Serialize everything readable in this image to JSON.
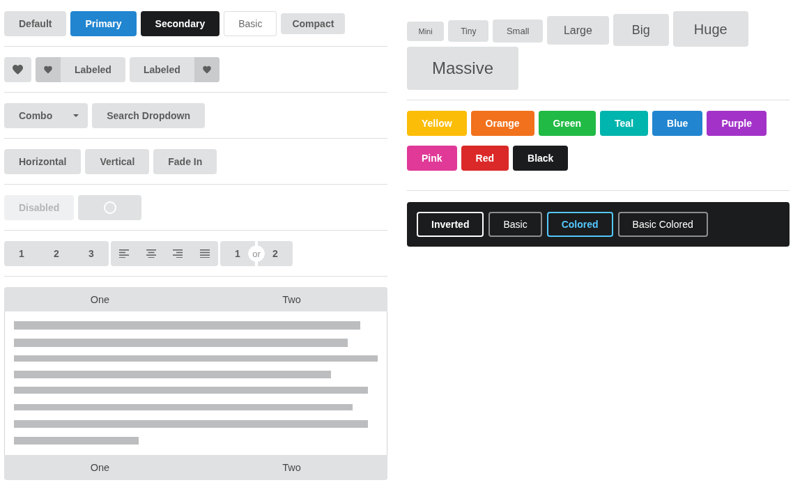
{
  "left": {
    "basic_buttons": [
      {
        "label": "Default",
        "kind": "default"
      },
      {
        "label": "Primary",
        "kind": "primary"
      },
      {
        "label": "Secondary",
        "kind": "secondary"
      },
      {
        "label": "Basic",
        "kind": "basic"
      },
      {
        "label": "Compact",
        "kind": "compact"
      }
    ],
    "icon_buttons": [
      {
        "kind": "icon"
      },
      {
        "kind": "labeled_left",
        "label": "Labeled"
      },
      {
        "kind": "labeled_right",
        "label": "Labeled"
      }
    ],
    "dropdown_buttons": [
      {
        "kind": "combo",
        "label": "Combo"
      },
      {
        "kind": "plain",
        "label": "Search Dropdown"
      }
    ],
    "animated_buttons": [
      {
        "label": "Horizontal"
      },
      {
        "label": "Vertical"
      },
      {
        "label": "Fade In"
      }
    ],
    "state_buttons": [
      {
        "kind": "text",
        "label": "Disabled",
        "disabled": true
      },
      {
        "kind": "loading",
        "disabled": false
      }
    ],
    "number_group": [
      "1",
      "2",
      "3"
    ],
    "align_group": [
      {
        "kind": "left"
      },
      {
        "kind": "center"
      },
      {
        "kind": "right"
      },
      {
        "kind": "justify"
      }
    ],
    "or_group": {
      "first": "1",
      "separator": "or",
      "second": "2"
    },
    "attached_top": [
      {
        "label": "One"
      },
      {
        "label": "Two"
      }
    ],
    "attached_bottom": [
      {
        "label": "One"
      },
      {
        "label": "Two"
      }
    ]
  },
  "right": {
    "size_buttons": [
      {
        "kind": "mini",
        "label": "Mini"
      },
      {
        "kind": "tiny",
        "label": "Tiny"
      },
      {
        "kind": "small",
        "label": "Small"
      },
      {
        "kind": "large",
        "label": "Large"
      },
      {
        "kind": "big",
        "label": "Big"
      },
      {
        "kind": "huge",
        "label": "Huge"
      },
      {
        "kind": "massive",
        "label": "Massive"
      }
    ],
    "colored_buttons": [
      {
        "label": "Yellow",
        "color": "#fbbd08"
      },
      {
        "label": "Orange",
        "color": "#f2711c"
      },
      {
        "label": "Green",
        "color": "#21ba45"
      },
      {
        "label": "Teal",
        "color": "#00b5ad"
      },
      {
        "label": "Blue",
        "color": "#2185d0"
      },
      {
        "label": "Purple",
        "color": "#a333c8"
      },
      {
        "label": "Pink",
        "color": "#e03997"
      },
      {
        "label": "Red",
        "color": "#db2828"
      },
      {
        "label": "Black",
        "color": "#1b1c1d"
      }
    ],
    "inverted_buttons": [
      {
        "kind": "inverted",
        "label": "Inverted"
      },
      {
        "kind": "basic",
        "label": "Basic"
      },
      {
        "kind": "colored",
        "label": "Colored"
      },
      {
        "kind": "basic_colored",
        "label": "Basic Colored"
      }
    ]
  }
}
